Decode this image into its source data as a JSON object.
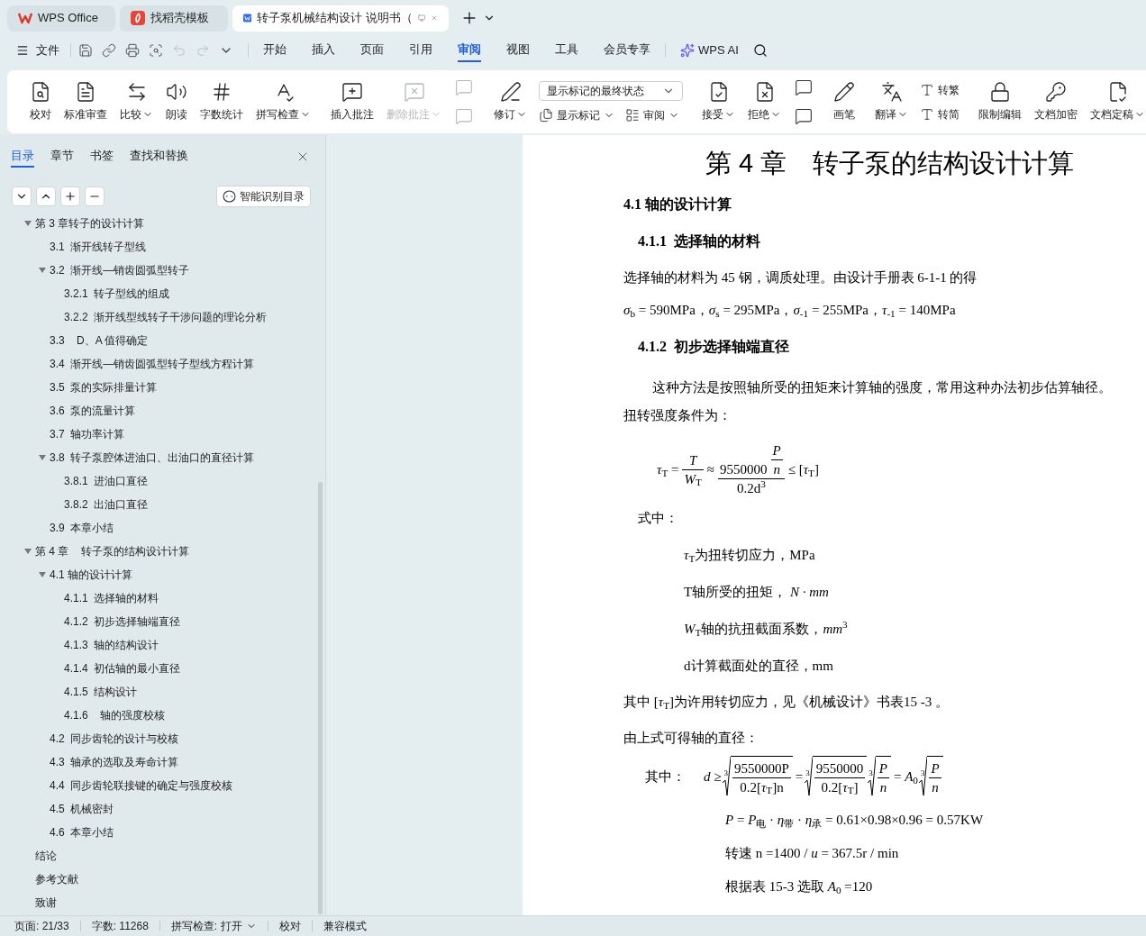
{
  "browser_tabs": [
    {
      "label": "WPS Office",
      "selected": false,
      "kind": "wps"
    },
    {
      "label": "找稻壳模板",
      "selected": false,
      "kind": "docer"
    },
    {
      "label": "转子泵机械结构设计 说明书（",
      "selected": true,
      "kind": "doc"
    }
  ],
  "menu": {
    "file": "文件",
    "tabs": [
      {
        "label": "开始",
        "selected": false
      },
      {
        "label": "插入",
        "selected": false
      },
      {
        "label": "页面",
        "selected": false
      },
      {
        "label": "引用",
        "selected": false
      },
      {
        "label": "审阅",
        "selected": true
      },
      {
        "label": "视图",
        "selected": false
      },
      {
        "label": "工具",
        "selected": false
      },
      {
        "label": "会员专享",
        "selected": false
      }
    ],
    "ai": "WPS AI"
  },
  "ribbon": [
    {
      "items": [
        {
          "kind": "big",
          "label": "校对",
          "caret": false,
          "disabled": false
        },
        {
          "kind": "big",
          "label": "标准审查",
          "caret": false,
          "disabled": false
        },
        {
          "kind": "big",
          "label": "比较",
          "caret": true,
          "disabled": false
        },
        {
          "kind": "big",
          "label": "朗读",
          "caret": false,
          "disabled": false
        },
        {
          "kind": "big",
          "label": "字数统计",
          "caret": false,
          "disabled": false
        },
        {
          "kind": "big",
          "label": "拼写检查",
          "caret": true,
          "disabled": false
        }
      ]
    },
    {
      "items": [
        {
          "kind": "big",
          "label": "插入批注",
          "caret": false,
          "disabled": false
        },
        {
          "kind": "big",
          "label": "删除批注",
          "caret": true,
          "disabled": true
        },
        {
          "kind": "icon_pair",
          "disabled": true
        }
      ]
    },
    {
      "items": [
        {
          "kind": "big",
          "label": "修订",
          "caret": true,
          "disabled": false
        },
        {
          "kind": "select_block",
          "value": "显示标记的最终状态",
          "buttons": [
            {
              "label": "显示标记",
              "caret": true
            },
            {
              "label": "审阅",
              "caret": true
            }
          ]
        }
      ]
    },
    {
      "items": [
        {
          "kind": "big",
          "label": "接受",
          "caret": true,
          "disabled": false
        },
        {
          "kind": "big",
          "label": "拒绝",
          "caret": true,
          "disabled": false
        },
        {
          "kind": "icon_pair",
          "disabled": false
        }
      ]
    },
    {
      "items": [
        {
          "kind": "big",
          "label": "画笔",
          "caret": false,
          "disabled": false
        }
      ]
    },
    {
      "items": [
        {
          "kind": "big",
          "label": "翻译",
          "caret": true,
          "disabled": false
        },
        {
          "kind": "small_stack",
          "buttons": [
            {
              "label": "转繁",
              "caret": false
            },
            {
              "label": "转简",
              "caret": false
            }
          ]
        }
      ]
    },
    {
      "items": [
        {
          "kind": "big",
          "label": "限制编辑",
          "caret": false,
          "disabled": false
        },
        {
          "kind": "big",
          "label": "文档加密",
          "caret": false,
          "disabled": false
        },
        {
          "kind": "big",
          "label": "文档定稿",
          "caret": true,
          "disabled": false
        }
      ]
    }
  ],
  "nav_pane": {
    "tabs": [
      {
        "label": "目录",
        "selected": true
      },
      {
        "label": "章节",
        "selected": false
      },
      {
        "label": "书签",
        "selected": false
      },
      {
        "label": "查找和替换",
        "selected": false
      }
    ],
    "smart_button": "智能识别目录",
    "toc": [
      {
        "label": "第 3 章转子的设计计算",
        "expanded": true,
        "children": [
          {
            "label": "3.1  渐开线转子型线"
          },
          {
            "label": "3.2  渐开线—销齿圆弧型转子",
            "expanded": true,
            "children": [
              {
                "label": "3.2.1  转子型线的组成"
              },
              {
                "label": "3.2.2  渐开线型线转子干涉问题的理论分析"
              }
            ]
          },
          {
            "label": "3.3    D、A 值得确定"
          },
          {
            "label": "3.4  渐开线—销齿圆弧型转子型线方程计算"
          },
          {
            "label": "3.5  泵的实际排量计算"
          },
          {
            "label": "3.6  泵的流量计算"
          },
          {
            "label": "3.7  轴功率计算"
          },
          {
            "label": "3.8  转子泵腔体进油口、出油口的直径计算",
            "expanded": true,
            "children": [
              {
                "label": "3.8.1  进油口直径"
              },
              {
                "label": "3.8.2  出油口直径"
              }
            ]
          },
          {
            "label": "3.9  本章小结"
          }
        ]
      },
      {
        "label": "第 4 章    转子泵的结构设计计算",
        "expanded": true,
        "children": [
          {
            "label": "4.1 轴的设计计算",
            "expanded": true,
            "children": [
              {
                "label": "4.1.1  选择轴的材料"
              },
              {
                "label": "4.1.2  初步选择轴端直径"
              },
              {
                "label": "4.1.3  轴的结构设计"
              },
              {
                "label": "4.1.4  初估轴的最小直径"
              },
              {
                "label": "4.1.5  结构设计"
              },
              {
                "label": "4.1.6    轴的强度校核"
              }
            ]
          },
          {
            "label": "4.2  同步齿轮的设计与校核"
          },
          {
            "label": "4.3  轴承的选取及寿命计算"
          },
          {
            "label": "4.4  同步齿轮联接键的确定与强度校核"
          },
          {
            "label": "4.5  机械密封"
          },
          {
            "label": "4.6  本章小结"
          }
        ]
      },
      {
        "label": "结论"
      },
      {
        "label": "参考文献"
      },
      {
        "label": "致谢"
      }
    ]
  },
  "document": [
    {
      "kind": "chapter",
      "text": "第 4 章　转子泵的结构设计计算"
    },
    {
      "kind": "h2",
      "text": "4.1 轴的设计计算"
    },
    {
      "kind": "h3",
      "text": "4.1.1  选择轴的材料"
    },
    {
      "kind": "para",
      "text": "选择轴的材料为 45 钢，调质处理。由设计手册表 6-1-1 的得"
    },
    {
      "kind": "math",
      "text": "*σ*$_{b}$ = 590MPa，*σ*$_{s}$ = 295MPa，*σ*$_{-1}$ = 255MPa，*τ*$_{-1}$ = 140MPa"
    },
    {
      "kind": "h3",
      "text": "4.1.2  初步选择轴端直径"
    },
    {
      "kind": "lines_para",
      "lines": [
        "这种方法是按照轴所受的扭矩来计算轴的强度，常用这种办法初步估算轴径。",
        "扭转强度条件为："
      ]
    },
    {
      "kind": "display",
      "tokens": [
        {
          "kind": "text",
          "text": "*τ*$_{T}$ ="
        },
        {
          "kind": "frac",
          "num": [
            {
              "kind": "text",
              "text": "*T*"
            }
          ],
          "den": [
            {
              "kind": "text",
              "text": "*W*$_{T}$"
            }
          ]
        },
        {
          "kind": "text",
          "text": "≈"
        },
        {
          "kind": "frac",
          "num": [
            {
              "kind": "text",
              "text": "9550000"
            },
            {
              "kind": "frac",
              "num": [
                {
                  "kind": "text",
                  "text": "*P*"
                }
              ],
              "den": [
                {
                  "kind": "text",
                  "text": "*n*"
                }
              ]
            }
          ],
          "den": [
            {
              "kind": "text",
              "text": "0.2d$^{3}$"
            }
          ]
        },
        {
          "kind": "text",
          "text": "≤ [*τ*$_{T}$]"
        }
      ]
    },
    {
      "kind": "label",
      "text": "式中："
    },
    {
      "kind": "def",
      "text": "*τ*$_{T}$为扭转切应力，MPa"
    },
    {
      "kind": "def",
      "text": "T轴所受的扭矩， *N · mm*"
    },
    {
      "kind": "def",
      "text": "*W*$_{T}$轴的抗扭截面系数，*mm*$^{3}$"
    },
    {
      "kind": "def",
      "text": "d计算截面处的直径，mm"
    },
    {
      "kind": "para",
      "text": "其中 [*τ*$_{T}$]为许用转切应力，见《机械设计》书表15 -3 。"
    },
    {
      "kind": "para",
      "text": "由上式可得轴的直径："
    },
    {
      "kind": "display",
      "label": "其中：",
      "tokens": [
        {
          "kind": "text",
          "text": "*d* ≥"
        },
        {
          "kind": "root",
          "index": "3",
          "body": [
            {
              "kind": "frac",
              "num": [
                {
                  "kind": "text",
                  "text": "9550000P"
                }
              ],
              "den": [
                {
                  "kind": "text",
                  "text": "0.2[*τ*$_{T}$]n"
                }
              ]
            }
          ]
        },
        {
          "kind": "text",
          "text": "="
        },
        {
          "kind": "root",
          "index": "3",
          "body": [
            {
              "kind": "frac",
              "num": [
                {
                  "kind": "text",
                  "text": "9550000"
                }
              ],
              "den": [
                {
                  "kind": "text",
                  "text": "0.2[*τ*$_{T}$]"
                }
              ]
            }
          ]
        },
        {
          "kind": "root",
          "index": "3",
          "body": [
            {
              "kind": "frac",
              "num": [
                {
                  "kind": "text",
                  "text": "*P*"
                }
              ],
              "den": [
                {
                  "kind": "text",
                  "text": "*n*"
                }
              ]
            }
          ]
        },
        {
          "kind": "text",
          "text": "= *A*$_{0}$"
        },
        {
          "kind": "root",
          "index": "3",
          "body": [
            {
              "kind": "frac",
              "num": [
                {
                  "kind": "text",
                  "text": "*P*"
                }
              ],
              "den": [
                {
                  "kind": "text",
                  "text": "*n*"
                }
              ]
            }
          ]
        }
      ]
    },
    {
      "kind": "math_indent",
      "text": "*P* = *P*$_{电}$ · *η*$_{带}$ · *η*$_{承}$ = 0.61×0.98×0.96 = 0.57KW"
    },
    {
      "kind": "math_indent",
      "text": "转速 n =1400 / *u* = 367.5r / min"
    },
    {
      "kind": "math_indent",
      "text": "根据表 15-3 选取 *A*$_{0}$ =120"
    }
  ],
  "status_bar": [
    {
      "text": "页面: 21/33",
      "caret": false
    },
    {
      "text": "字数: 11268",
      "caret": false
    },
    {
      "text": "拼写检查: 打开",
      "caret": true
    },
    {
      "text": "校对",
      "caret": false
    },
    {
      "text": "兼容模式",
      "caret": false
    }
  ]
}
